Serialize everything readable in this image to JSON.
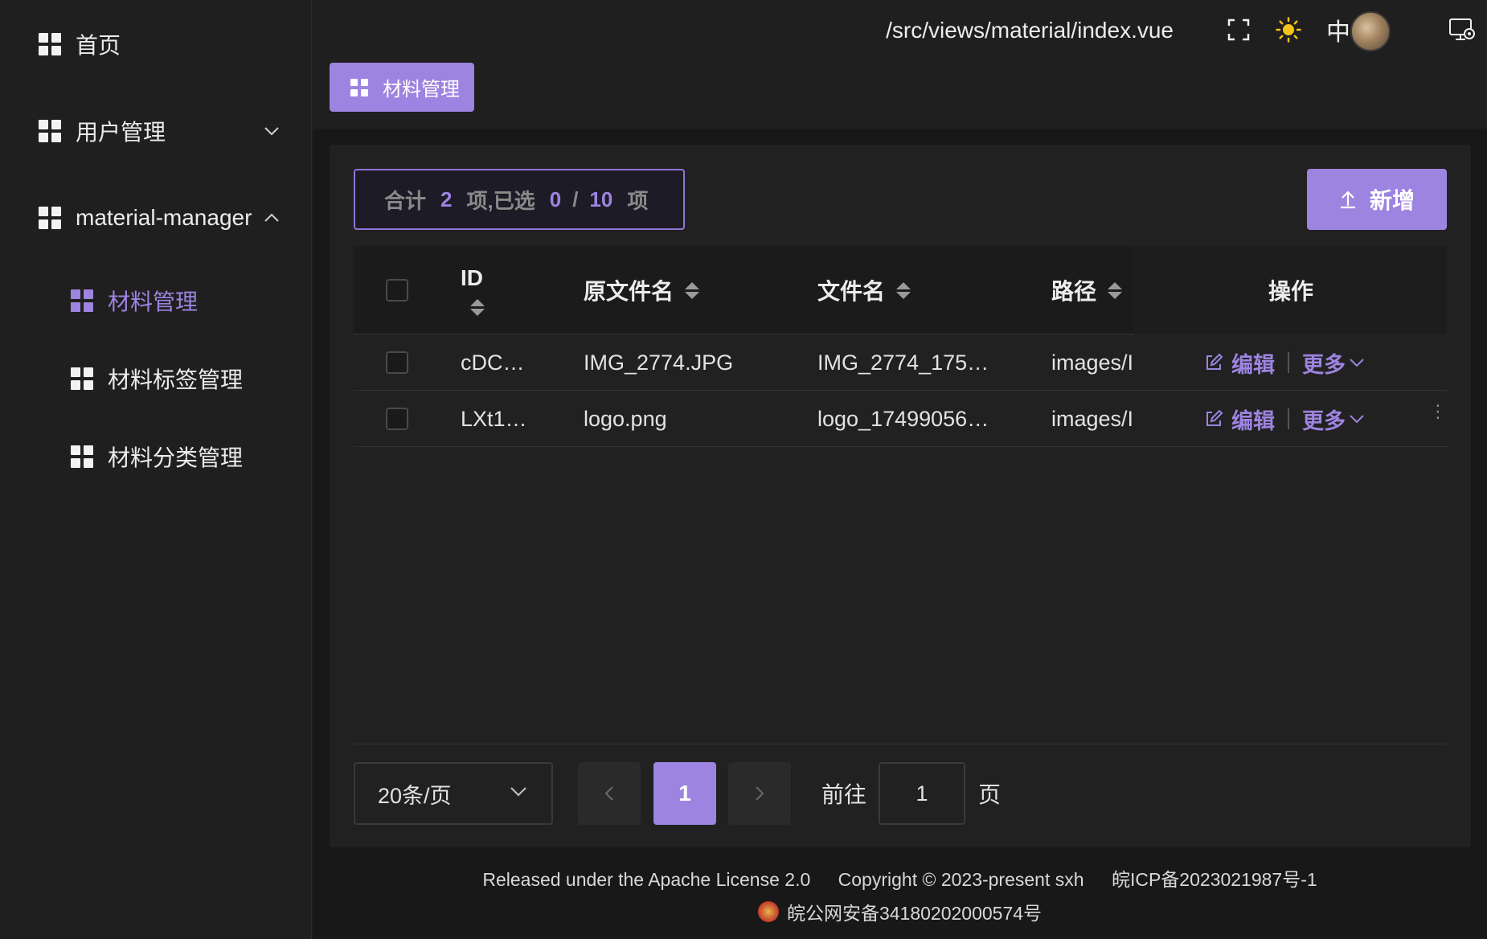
{
  "sidebar": {
    "items": [
      {
        "label": "首页"
      },
      {
        "label": "用户管理"
      },
      {
        "label": "material-manager"
      }
    ],
    "sub_items": [
      {
        "label": "材料管理"
      },
      {
        "label": "材料标签管理"
      },
      {
        "label": "材料分类管理"
      }
    ]
  },
  "header": {
    "path": "/src/views/material/index.vue",
    "lang": "中"
  },
  "tags": [
    {
      "label": "材料管理"
    }
  ],
  "summary": {
    "prefix": "合计",
    "total": "2",
    "mid": "项,已选",
    "selected": "0",
    "slash": "/",
    "page_size": "10",
    "suffix": "项"
  },
  "toolbar": {
    "add_label": "新增"
  },
  "table": {
    "columns": [
      "ID",
      "原文件名",
      "文件名",
      "路径",
      "操作"
    ],
    "rows": [
      {
        "id": "cDC…",
        "orig_name": "IMG_2774.JPG",
        "file_name": "IMG_2774_175…",
        "path": "images/I",
        "edit": "编辑",
        "more": "更多"
      },
      {
        "id": "LXt1…",
        "orig_name": "logo.png",
        "file_name": "logo_17499056…",
        "path": "images/I",
        "edit": "编辑",
        "more": "更多"
      }
    ]
  },
  "pagination": {
    "page_size_label": "20条/页",
    "current_page": "1",
    "goto_label": "前往",
    "goto_value": "1",
    "page_suffix": "页"
  },
  "footer": {
    "license": "Released under the Apache License 2.0",
    "copyright": "Copyright © 2023-present sxh",
    "icp": "皖ICP备2023021987号-1",
    "police": "皖公网安备34180202000574号"
  },
  "colors": {
    "accent": "#9d84e0",
    "background": "#1f1f1f"
  }
}
